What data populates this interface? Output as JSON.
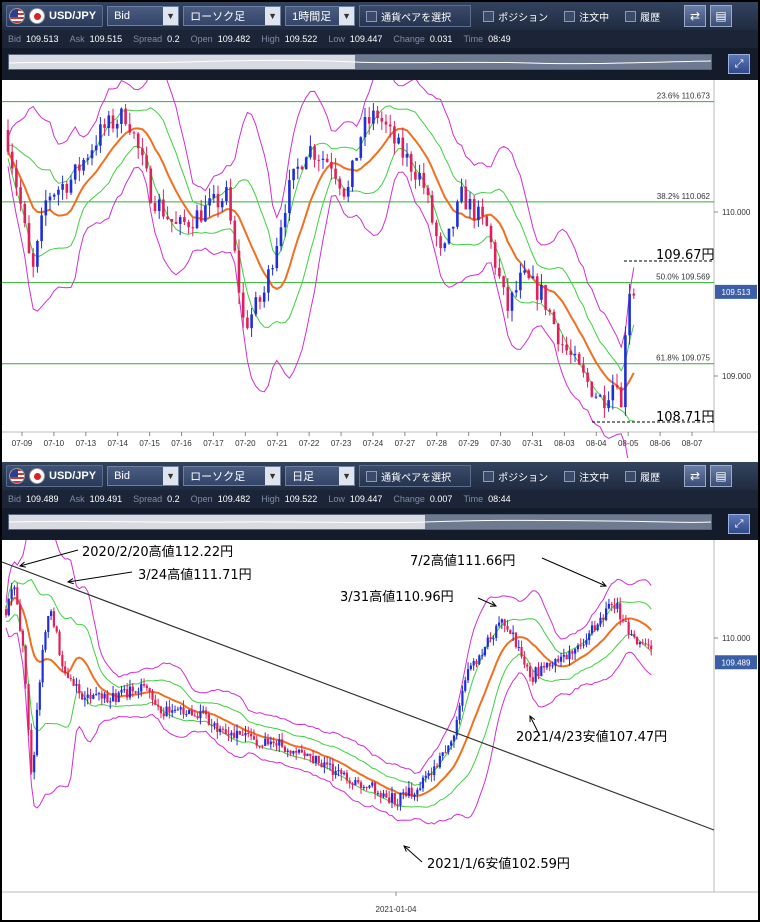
{
  "top": {
    "toolbar": {
      "pair": "USD/JPY",
      "price_type": "Bid",
      "chart_type": "ローソク足",
      "timeframe": "1時間足",
      "pair_select": "通貨ペアを選択",
      "positions": "ポジション",
      "orders": "注文中",
      "history": "履歴"
    },
    "quotes": {
      "bid_label": "Bid",
      "bid": "109.513",
      "ask_label": "Ask",
      "ask": "109.515",
      "spread_label": "Spread",
      "spread": "0.2",
      "open_label": "Open",
      "open": "109.482",
      "high_label": "High",
      "high": "109.522",
      "low_label": "Low",
      "low": "109.447",
      "change_label": "Change",
      "change": "0.031",
      "time_label": "Time",
      "time": "08:49"
    },
    "fib_levels": [
      {
        "label": "23.6%",
        "price": "110.673",
        "value": 110.673
      },
      {
        "label": "38.2%",
        "price": "110.062",
        "value": 110.062
      },
      {
        "label": "50.0%",
        "price": "109.569",
        "value": 109.569
      },
      {
        "label": "61.8%",
        "price": "109.075",
        "value": 109.075
      }
    ],
    "y_ticks": [
      {
        "label": "110.000",
        "value": 110.0
      },
      {
        "label": "109.000",
        "value": 109.0
      }
    ],
    "current_price": "109.513",
    "x_ticks": [
      "07-09",
      "07-10",
      "07-13",
      "07-14",
      "07-15",
      "07-16",
      "07-17",
      "07-20",
      "07-21",
      "07-22",
      "07-23",
      "07-24",
      "07-27",
      "07-28",
      "07-29",
      "07-30",
      "07-31",
      "08-03",
      "08-04",
      "08-05",
      "08-06",
      "08-07"
    ],
    "annotations": {
      "high": "109.67円",
      "low": "108.71円"
    },
    "colors": {
      "candle_up": "#1f2fd6",
      "candle_down": "#e0205a",
      "ma": "#f07020",
      "bb_inner": "#40d040",
      "bb_outer": "#d030d0",
      "fib": "#30b030"
    }
  },
  "bottom": {
    "toolbar": {
      "pair": "USD/JPY",
      "price_type": "Bid",
      "chart_type": "ローソク足",
      "timeframe": "日足",
      "pair_select": "通貨ペアを選択",
      "positions": "ポジション",
      "orders": "注文中",
      "history": "履歴"
    },
    "quotes": {
      "bid_label": "Bid",
      "bid": "109.489",
      "ask_label": "Ask",
      "ask": "109.491",
      "spread_label": "Spread",
      "spread": "0.2",
      "open_label": "Open",
      "open": "109.482",
      "high_label": "High",
      "high": "109.522",
      "low_label": "Low",
      "low": "109.447",
      "change_label": "Change",
      "change": "0.007",
      "time_label": "Time",
      "time": "08:44"
    },
    "y_ticks": [
      {
        "label": "110.000",
        "value": 110.0
      }
    ],
    "current_price": "109.489",
    "x_tick": "2021-01-04",
    "annotations": {
      "a1": "2020/2/20高値112.22円",
      "a2": "3/24高値111.71円",
      "a3": "3/31高値110.96円",
      "a4": "7/2高値111.66円",
      "a5": "2021/4/23安値107.47円",
      "a6": "2021/1/6安値102.59円"
    }
  }
}
